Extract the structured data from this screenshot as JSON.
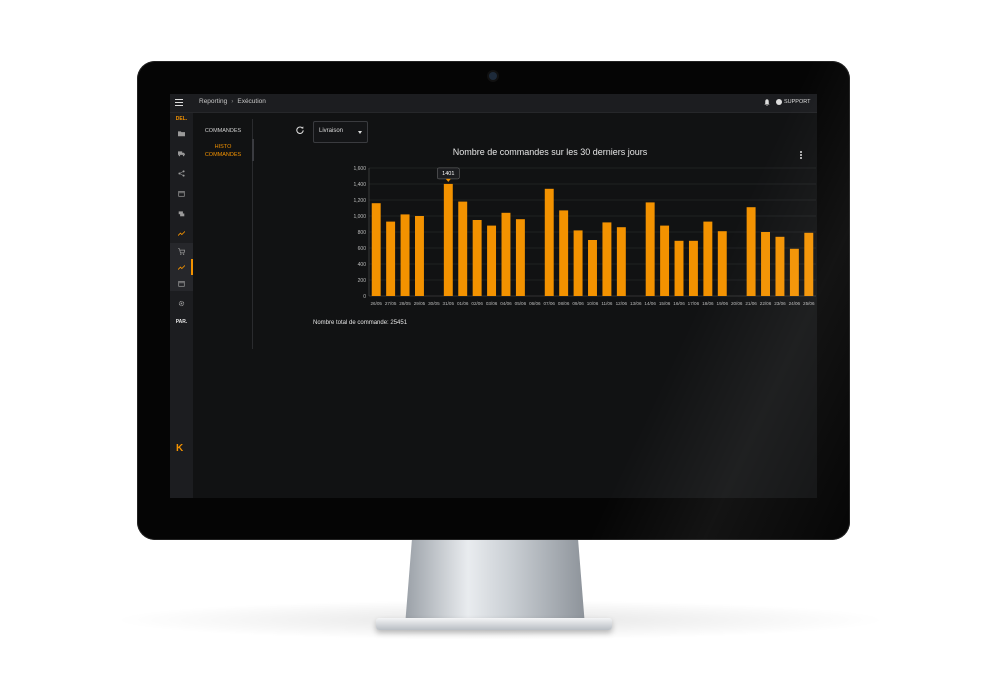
{
  "breadcrumb": {
    "section": "Reporting",
    "page": "Exécution"
  },
  "header": {
    "support_label": "SUPPORT"
  },
  "rail": {
    "top_label": "DEL.",
    "bottom_label": "PAR.",
    "logo": "K"
  },
  "submenu": {
    "items": [
      {
        "label": "COMMANDES"
      },
      {
        "label_line1": "HISTO",
        "label_line2": "COMMANDES"
      }
    ]
  },
  "filter": {
    "selected": "Livraison"
  },
  "chart": {
    "title": "Nombre de commandes sur les 30 derniers jours",
    "tooltip": "1401"
  },
  "summary": {
    "total_label": "Nombre total de commande: 25451"
  },
  "colors": {
    "accent": "#f39200",
    "background": "#111213",
    "panel": "#1c1d20"
  },
  "icons": [
    "menu-icon",
    "bell-icon",
    "user-icon",
    "refresh-icon",
    "kebab-icon"
  ],
  "chart_data": {
    "type": "bar",
    "title": "Nombre de commandes sur les 30 derniers jours",
    "categories": [
      "26/05",
      "27/05",
      "28/05",
      "29/05",
      "30/05",
      "31/05",
      "01/06",
      "02/06",
      "03/06",
      "04/06",
      "05/06",
      "06/06",
      "07/06",
      "08/06",
      "09/06",
      "10/06",
      "11/06",
      "12/06",
      "13/06",
      "14/06",
      "15/06",
      "16/06",
      "17/06",
      "18/06",
      "19/06",
      "20/06",
      "21/06",
      "22/06",
      "23/06",
      "24/06",
      "25/06"
    ],
    "values": [
      1160,
      930,
      1020,
      1000,
      0,
      1401,
      1180,
      950,
      880,
      1040,
      960,
      0,
      1340,
      1070,
      820,
      700,
      920,
      860,
      0,
      1170,
      880,
      690,
      690,
      930,
      810,
      0,
      1110,
      800,
      740,
      590,
      790
    ],
    "ylim": [
      0,
      1600
    ],
    "yticks": [
      "0",
      "200",
      "400",
      "600",
      "800",
      "1,000",
      "1,200",
      "1,400",
      "1,600"
    ],
    "grid": true,
    "highlight_index": 5
  }
}
